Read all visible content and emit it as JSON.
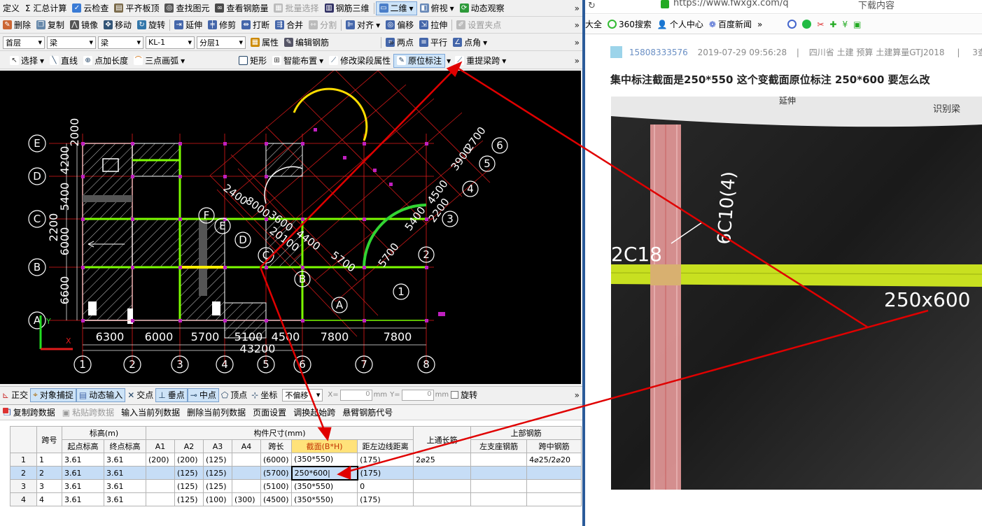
{
  "toolbar1": {
    "items": [
      "定义",
      "Σ 汇总计算",
      "云检查",
      "平齐板顶",
      "查找图元",
      "查看钢筋量",
      "批量选择",
      "钢筋三维",
      "二维",
      "俯视",
      "动态观察"
    ],
    "more": "»"
  },
  "toolbar2": {
    "items": [
      "删除",
      "复制",
      "镜像",
      "移动",
      "旋转",
      "延伸",
      "修剪",
      "打断",
      "合并",
      "分割",
      "对齐",
      "偏移",
      "拉伸",
      "设置夹点"
    ],
    "more": "»"
  },
  "toolbar3": {
    "floor": "首层",
    "category": "梁",
    "type": "梁",
    "element": "KL-1",
    "layer": "分层1",
    "items": [
      "属性",
      "编辑钢筋",
      "两点",
      "平行",
      "点角"
    ],
    "more": "»"
  },
  "toolbar4": {
    "items": [
      "选择",
      "直线",
      "点加长度",
      "三点画弧",
      "矩形",
      "智能布置",
      "修改梁段属性",
      "原位标注",
      "重提梁跨"
    ],
    "more": "»"
  },
  "cad": {
    "dim_bottom": [
      "6300",
      "6000",
      "5700",
      "5100",
      "4500",
      "7800",
      "7800"
    ],
    "dim_total": "43200",
    "dim_left": [
      "2000",
      "4200",
      "5400",
      "2200",
      "6000",
      "6600"
    ],
    "axis_bottom": [
      "1",
      "2",
      "3",
      "4",
      "5",
      "6",
      "7",
      "8"
    ],
    "axis_left": [
      "E",
      "D",
      "C",
      "B",
      "A"
    ],
    "axis_right": [
      "6",
      "5",
      "4",
      "3",
      "2",
      "1"
    ],
    "axis_inner": [
      "F",
      "E",
      "D",
      "C",
      "B",
      "A"
    ],
    "dim_diag": [
      "2400",
      "8000",
      "3600",
      "20100",
      "4400",
      "5700",
      "5700",
      "5400",
      "4500",
      "2200",
      "3900",
      "2700"
    ],
    "ucs": [
      "Y",
      "X"
    ]
  },
  "snapbar": {
    "items": [
      "正交",
      "对象捕捉",
      "动态输入",
      "交点",
      "垂点",
      "中点",
      "顶点",
      "坐标"
    ],
    "offset_select": "不偏移",
    "x_label": "X=",
    "x_value": "0",
    "x_unit": "mm",
    "y_label": "Y=",
    "y_value": "0",
    "y_unit": "mm",
    "rotate": "旋转",
    "more": "»"
  },
  "panel": {
    "toolbar": [
      "复制跨数据",
      "粘贴跨数据",
      "输入当前列数据",
      "删除当前列数据",
      "页面设置",
      "调换起始跨",
      "悬臂钢筋代号"
    ],
    "headers": {
      "span": "跨号",
      "elev": "标高(m)",
      "start_elev": "起点标高",
      "end_elev": "终点标高",
      "size": "构件尺寸(mm)",
      "a1": "A1",
      "a2": "A2",
      "a3": "A3",
      "a4": "A4",
      "span_len": "跨长",
      "section": "截面(B*H)",
      "edge_dist": "距左边线距离",
      "top_through": "上通长筋",
      "top_rebar": "上部钢筋",
      "left_seat": "左支座钢筋",
      "mid_span": "跨中钢筋"
    },
    "rows": [
      {
        "n": "1",
        "span": "1",
        "start": "3.61",
        "end": "3.61",
        "a1": "(200)",
        "a2": "(200)",
        "a3": "(125)",
        "a4": "",
        "len": "(6000)",
        "section": "(350*550)",
        "dist": "(175)",
        "through": "2⌀25",
        "left": "",
        "mid": "4⌀25/2⌀20"
      },
      {
        "n": "2",
        "span": "2",
        "start": "3.61",
        "end": "3.61",
        "a1": "",
        "a2": "(125)",
        "a3": "(125)",
        "a4": "",
        "len": "(5700)",
        "section": "250*600|",
        "dist": "(175)",
        "through": "",
        "left": "",
        "mid": ""
      },
      {
        "n": "3",
        "span": "3",
        "start": "3.61",
        "end": "3.61",
        "a1": "",
        "a2": "(125)",
        "a3": "(125)",
        "a4": "",
        "len": "(5100)",
        "section": "(350*550)",
        "dist": "0",
        "through": "",
        "left": "",
        "mid": ""
      },
      {
        "n": "4",
        "span": "4",
        "start": "3.61",
        "end": "3.61",
        "a1": "",
        "a2": "(125)",
        "a3": "(100)",
        "a4": "(300)",
        "len": "(4500)",
        "section": "(350*550)",
        "dist": "(175)",
        "through": "",
        "left": "",
        "mid": ""
      }
    ]
  },
  "browser": {
    "url": "https://www.fwxgx.com/q",
    "top_right": "下载内容",
    "favorites": [
      "大全",
      "360搜索",
      "个人中心",
      "百度新闻",
      "»"
    ],
    "meta": {
      "user": "15808333576",
      "date": "2019-07-29 09:56:28",
      "sep": "|",
      "tags": "四川省  土建 预算 土建算量GTJ2018",
      "sep2": "|",
      "views": "3查"
    },
    "title": "集中标注截面是250*550 这个变截面原位标注 250*600 要怎么改",
    "photo": {
      "label_top": "识别梁",
      "label_top_left": "延伸",
      "rebar_left": "2C18",
      "rebar_vertical": "6C10(4)",
      "section": "250x600"
    }
  },
  "colors": {
    "cad_bg": "#000000",
    "grid_red": "#e11b1b",
    "beam_green": "#7cfc00",
    "beam_yellow": "#ffee00",
    "arrow_red": "#e00000",
    "header_yellow": "#ffe27a",
    "select_blue": "#c6ddf6"
  }
}
